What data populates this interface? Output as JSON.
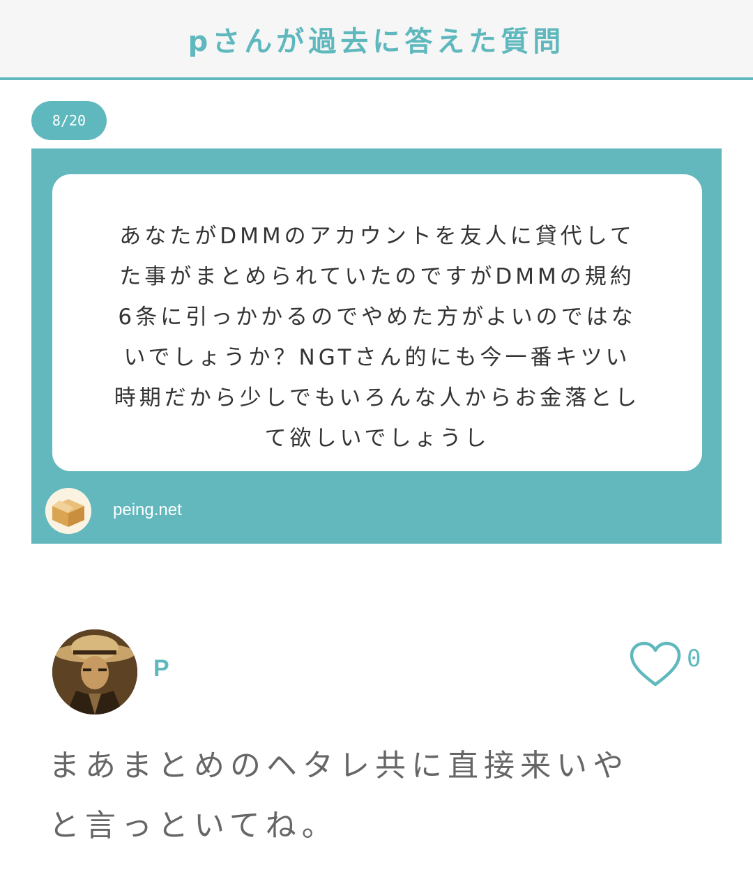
{
  "header": {
    "title": "pさんが過去に答えた質問"
  },
  "counter": {
    "label": "8/20"
  },
  "question": {
    "lines": [
      "あなたがDMMのアカウントを友人に貸代して",
      "た事がまとめられていたのですがDMMの規約",
      "6条に引っかかるのでやめた方がよいのではな",
      "いでしょうか？NGTさん的にも今一番キツい",
      "時期だから少しでもいろんな人からお金落とし",
      "て欲しいでしょうし"
    ],
    "source": {
      "label": "peing.net",
      "icon": "cardboard-box-icon"
    }
  },
  "answerer": {
    "name": "P",
    "avatar": "user-avatar-photo"
  },
  "like": {
    "icon": "heart-icon",
    "count": "0"
  },
  "answer": {
    "lines": [
      "まあまとめのヘタレ共に直接来いや",
      "と言っといてね。"
    ]
  },
  "colors": {
    "accent": "#5fb8bd",
    "card": "#62b8bd",
    "text": "#333333",
    "answer_text": "#666666"
  }
}
